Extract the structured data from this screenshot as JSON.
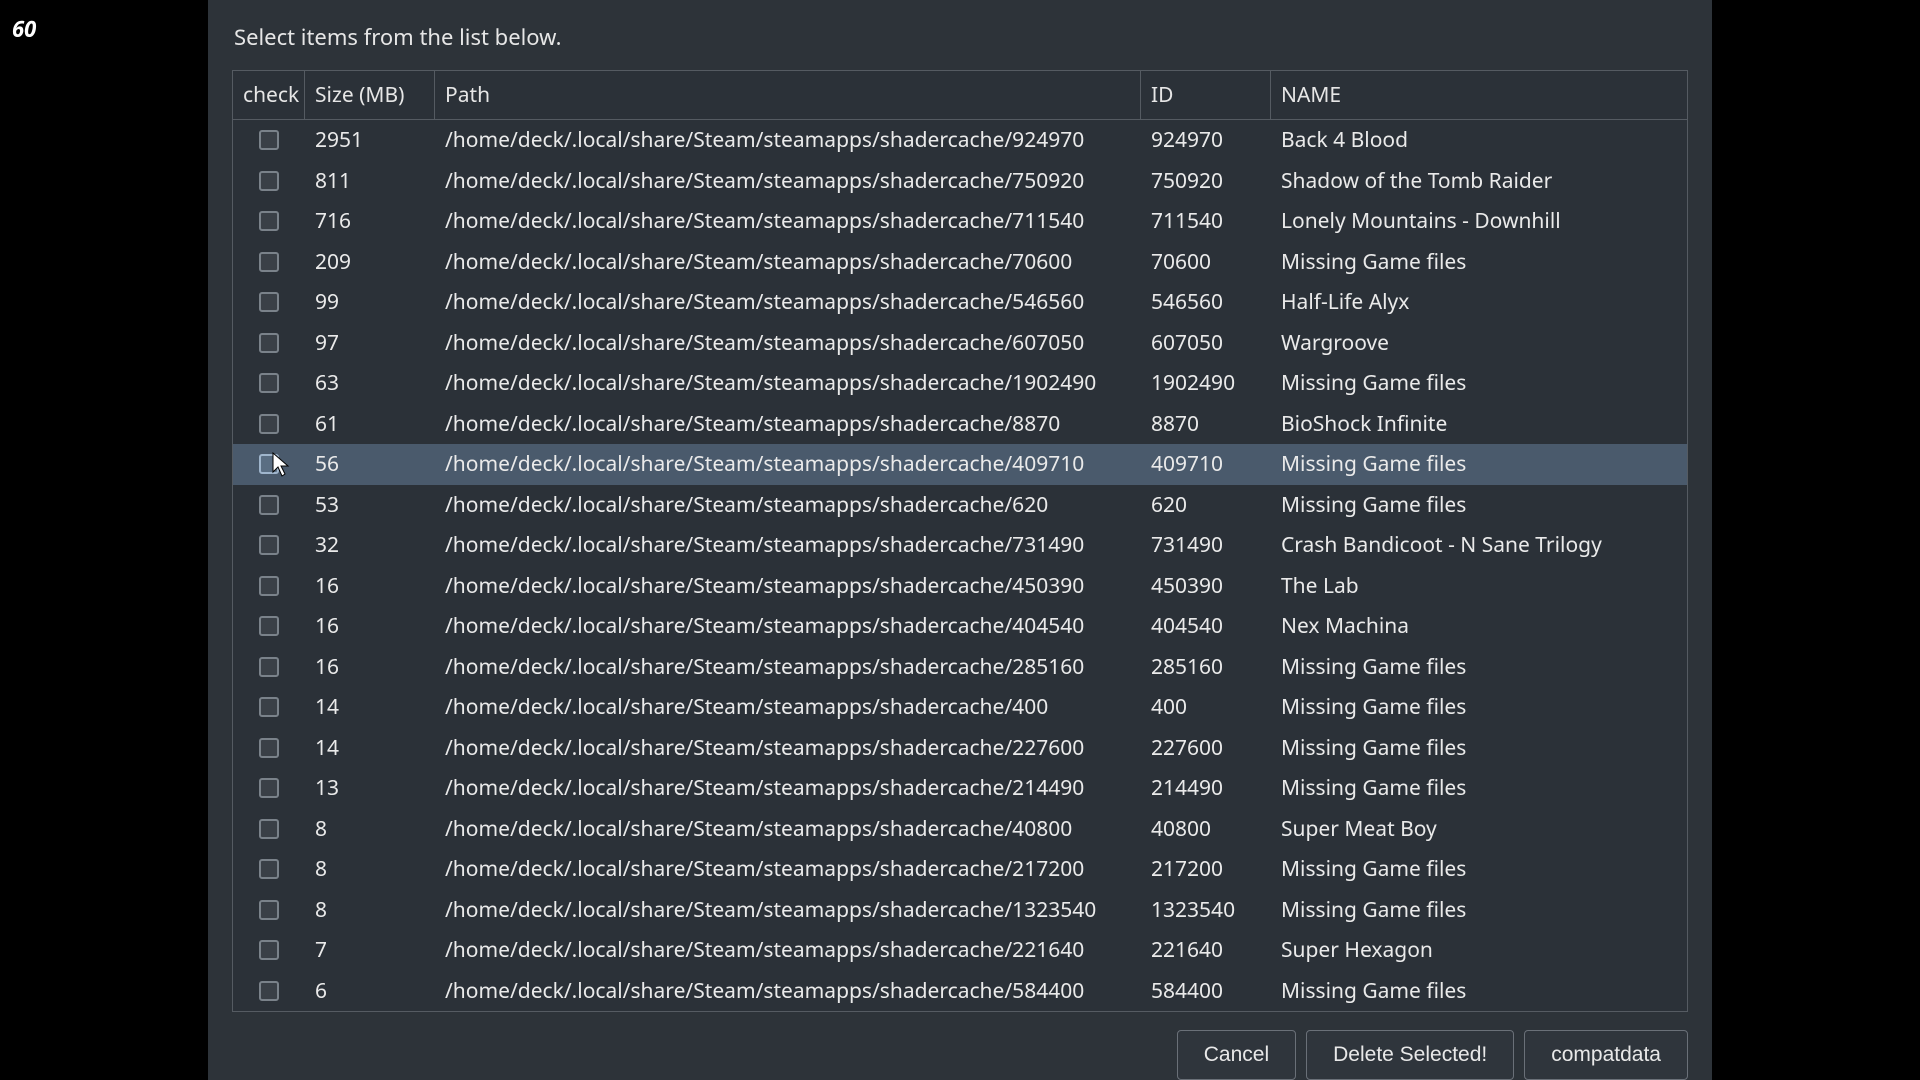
{
  "fps_overlay": "60",
  "instruction": "Select items from the list below.",
  "columns": {
    "check": "check",
    "size": "Size (MB)",
    "path": "Path",
    "id": "ID",
    "name": "NAME"
  },
  "selected_index": 8,
  "rows": [
    {
      "size": "2951",
      "path": "/home/deck/.local/share/Steam/steamapps/shadercache/924970",
      "id": "924970",
      "name": "Back 4 Blood"
    },
    {
      "size": "811",
      "path": "/home/deck/.local/share/Steam/steamapps/shadercache/750920",
      "id": "750920",
      "name": "Shadow of the Tomb Raider"
    },
    {
      "size": "716",
      "path": "/home/deck/.local/share/Steam/steamapps/shadercache/711540",
      "id": "711540",
      "name": "Lonely Mountains - Downhill"
    },
    {
      "size": "209",
      "path": "/home/deck/.local/share/Steam/steamapps/shadercache/70600",
      "id": "70600",
      "name": "Missing Game files"
    },
    {
      "size": "99",
      "path": "/home/deck/.local/share/Steam/steamapps/shadercache/546560",
      "id": "546560",
      "name": "Half-Life Alyx"
    },
    {
      "size": "97",
      "path": "/home/deck/.local/share/Steam/steamapps/shadercache/607050",
      "id": "607050",
      "name": "Wargroove"
    },
    {
      "size": "63",
      "path": "/home/deck/.local/share/Steam/steamapps/shadercache/1902490",
      "id": "1902490",
      "name": "Missing Game files"
    },
    {
      "size": "61",
      "path": "/home/deck/.local/share/Steam/steamapps/shadercache/8870",
      "id": "8870",
      "name": "BioShock Infinite"
    },
    {
      "size": "56",
      "path": "/home/deck/.local/share/Steam/steamapps/shadercache/409710",
      "id": "409710",
      "name": "Missing Game files"
    },
    {
      "size": "53",
      "path": "/home/deck/.local/share/Steam/steamapps/shadercache/620",
      "id": "620",
      "name": "Missing Game files"
    },
    {
      "size": "32",
      "path": "/home/deck/.local/share/Steam/steamapps/shadercache/731490",
      "id": "731490",
      "name": "Crash Bandicoot - N Sane Trilogy"
    },
    {
      "size": "16",
      "path": "/home/deck/.local/share/Steam/steamapps/shadercache/450390",
      "id": "450390",
      "name": "The Lab"
    },
    {
      "size": "16",
      "path": "/home/deck/.local/share/Steam/steamapps/shadercache/404540",
      "id": "404540",
      "name": "Nex Machina"
    },
    {
      "size": "16",
      "path": "/home/deck/.local/share/Steam/steamapps/shadercache/285160",
      "id": "285160",
      "name": "Missing Game files"
    },
    {
      "size": "14",
      "path": "/home/deck/.local/share/Steam/steamapps/shadercache/400",
      "id": "400",
      "name": "Missing Game files"
    },
    {
      "size": "14",
      "path": "/home/deck/.local/share/Steam/steamapps/shadercache/227600",
      "id": "227600",
      "name": "Missing Game files"
    },
    {
      "size": "13",
      "path": "/home/deck/.local/share/Steam/steamapps/shadercache/214490",
      "id": "214490",
      "name": "Missing Game files"
    },
    {
      "size": "8",
      "path": "/home/deck/.local/share/Steam/steamapps/shadercache/40800",
      "id": "40800",
      "name": "Super Meat Boy"
    },
    {
      "size": "8",
      "path": "/home/deck/.local/share/Steam/steamapps/shadercache/217200",
      "id": "217200",
      "name": "Missing Game files"
    },
    {
      "size": "8",
      "path": "/home/deck/.local/share/Steam/steamapps/shadercache/1323540",
      "id": "1323540",
      "name": "Missing Game files"
    },
    {
      "size": "7",
      "path": "/home/deck/.local/share/Steam/steamapps/shadercache/221640",
      "id": "221640",
      "name": "Super Hexagon"
    },
    {
      "size": "6",
      "path": "/home/deck/.local/share/Steam/steamapps/shadercache/584400",
      "id": "584400",
      "name": "Missing Game files"
    }
  ],
  "buttons": {
    "cancel": "Cancel",
    "delete": "Delete Selected!",
    "compatdata": "compatdata"
  }
}
